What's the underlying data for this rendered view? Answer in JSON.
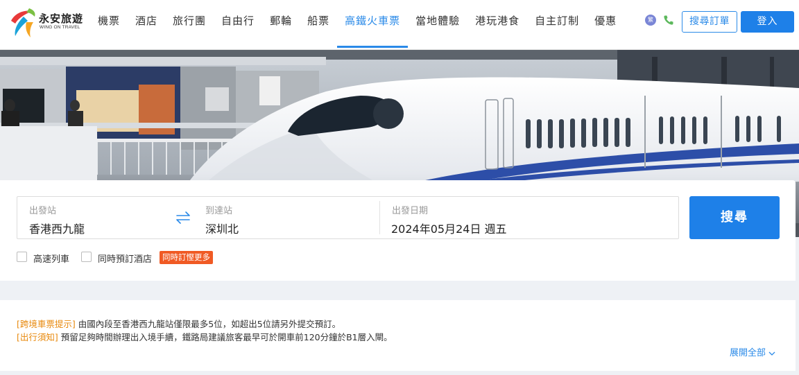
{
  "brand": {
    "name_cn": "永安旅遊",
    "name_en": "WING ON TRAVEL",
    "colors": {
      "primary": "#1e80e8",
      "accent_orange": "#f05a24",
      "notice_tag": "#e8890c"
    }
  },
  "nav": {
    "items": [
      {
        "label": "機票",
        "active": false
      },
      {
        "label": "酒店",
        "active": false
      },
      {
        "label": "旅行團",
        "active": false
      },
      {
        "label": "自由行",
        "active": false
      },
      {
        "label": "郵輪",
        "active": false
      },
      {
        "label": "船票",
        "active": false
      },
      {
        "label": "高鐵火車票",
        "active": true
      },
      {
        "label": "當地體驗",
        "active": false
      },
      {
        "label": "港玩港食",
        "active": false
      },
      {
        "label": "自主訂制",
        "active": false
      },
      {
        "label": "優惠",
        "active": false
      }
    ]
  },
  "header": {
    "lang_icon_text": "繁",
    "order_lookup_label": "搜尋訂單",
    "login_label": "登入"
  },
  "search": {
    "from_label": "出發站",
    "from_value": "香港西九龍",
    "to_label": "到達站",
    "to_value": "深圳北",
    "date_label": "出發日期",
    "date_value": "2024年05月24日 週五",
    "search_label": "搜尋",
    "options": [
      {
        "label": "高速列車",
        "checked": false
      },
      {
        "label": "同時預訂酒店",
        "checked": false
      }
    ],
    "promo_tag": "同時訂慳更多"
  },
  "notice": {
    "lines": [
      {
        "tag": "[跨境車票提示]",
        "text": " 由國內段至香港西九龍站僅限最多5位，如超出5位請另外提交預訂。"
      },
      {
        "tag": "[出行須知]",
        "text": " 預留足夠時間辦理出入境手續，鐵路局建議旅客最早可於開車前120分鐘於B1層入閘。"
      }
    ],
    "expand_label": "展開全部"
  }
}
